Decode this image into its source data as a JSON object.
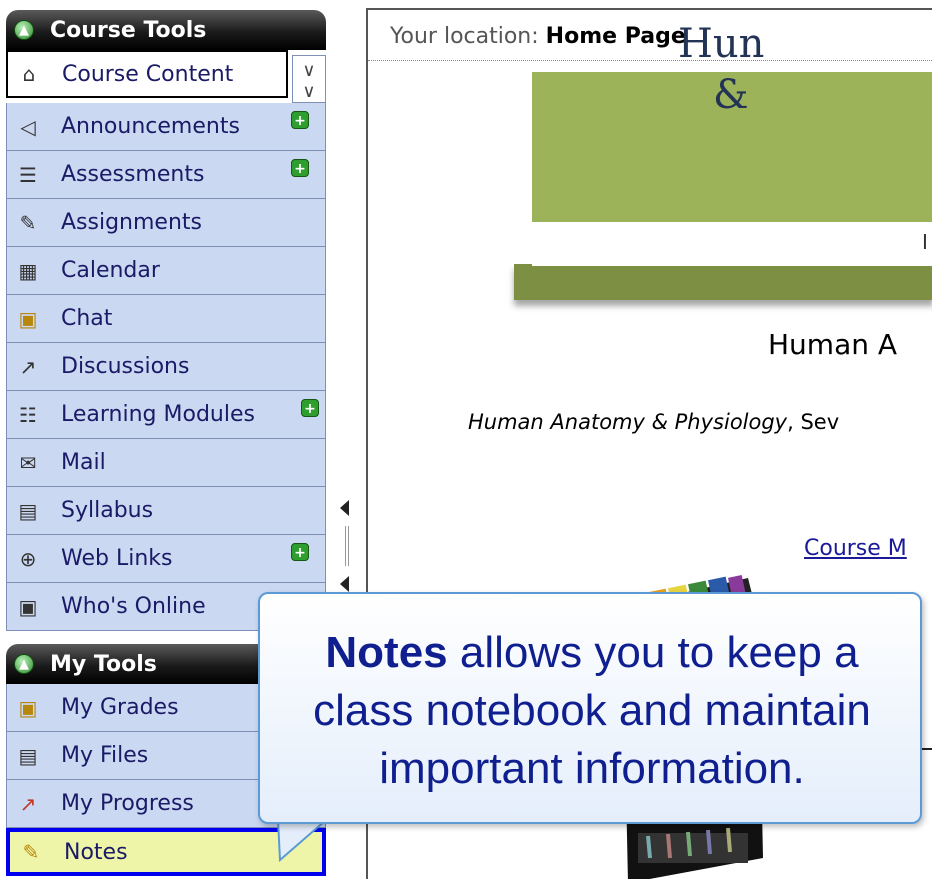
{
  "course_tools": {
    "header": "Course Tools",
    "items": [
      {
        "label": "Course Content",
        "icon": "house-icon"
      },
      {
        "label": "Announcements",
        "icon": "megaphone-icon",
        "new": true
      },
      {
        "label": "Assessments",
        "icon": "assessment-icon",
        "new": true
      },
      {
        "label": "Assignments",
        "icon": "assignment-icon"
      },
      {
        "label": "Calendar",
        "icon": "calendar-icon"
      },
      {
        "label": "Chat",
        "icon": "chat-bubble-icon"
      },
      {
        "label": "Discussions",
        "icon": "pushpin-icon"
      },
      {
        "label": "Learning Modules",
        "icon": "document-stack-icon",
        "new": true
      },
      {
        "label": "Mail",
        "icon": "envelope-icon"
      },
      {
        "label": "Syllabus",
        "icon": "syllabus-icon"
      },
      {
        "label": "Web Links",
        "icon": "globe-link-icon",
        "new": true
      },
      {
        "label": "Who's Online",
        "icon": "person-card-icon"
      }
    ]
  },
  "my_tools": {
    "header": "My Tools",
    "items": [
      {
        "label": "My Grades",
        "icon": "grades-icon"
      },
      {
        "label": "My Files",
        "icon": "files-icon"
      },
      {
        "label": "My Progress",
        "icon": "progress-chart-icon"
      },
      {
        "label": "Notes",
        "icon": "notes-icon"
      }
    ]
  },
  "location": {
    "prefix": "Your location:",
    "page": "Home Page"
  },
  "banner": {
    "title_line1": "Hun",
    "title_line2": "&",
    "strip_char": "I"
  },
  "course": {
    "heading": "Human A",
    "sub_italic": "Human Anatomy & Physiology",
    "sub_rest": ", Sev",
    "link": "Course M"
  },
  "callout": {
    "bold": "Notes",
    "line1_rest": " allows you to keep a",
    "line2": "class notebook and maintain",
    "line3": "important information."
  },
  "colors": {
    "sidebar_item_bg": "#cbd8f2",
    "banner_green": "#9db35a",
    "callout_border": "#5b9ad5",
    "selected_notes_bg": "#eef5a8"
  }
}
